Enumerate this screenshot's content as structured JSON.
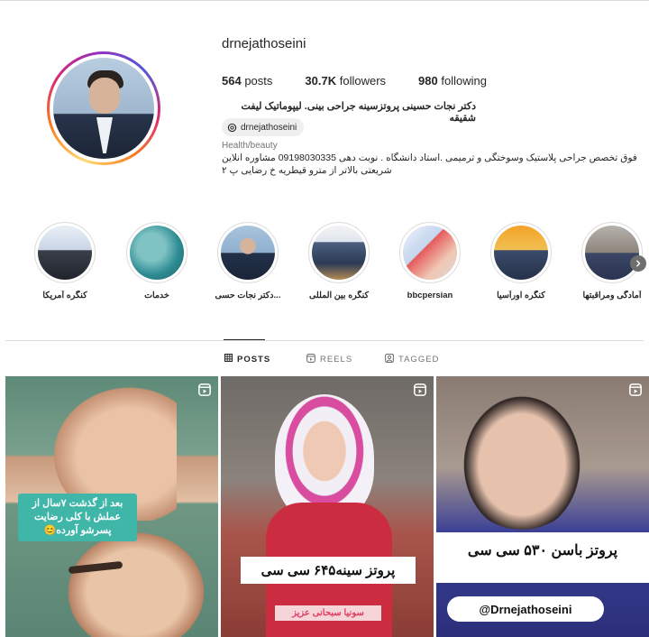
{
  "profile": {
    "username": "drnejathoseini",
    "stats": [
      {
        "value": "564",
        "label": "posts"
      },
      {
        "value": "30.7K",
        "label": "followers"
      },
      {
        "value": "980",
        "label": "following"
      }
    ],
    "bio_name": "دکتر نجات حسینی پروتزسینه جراحی بینی. لیپوماتیک لیفت شقیقه",
    "threads_handle": "drnejathoseini",
    "category": "Health/beauty",
    "bio_line1": "فوق تخصص جراحی پلاستیک وسوختگی و ترمیمی .استاد دانشگاه . نوبت دهی 09198030335 مشاوره انلاین",
    "bio_line2": "شریعتی بالاتر از مترو قیطریه خ رضایی پ ۲"
  },
  "highlights": [
    {
      "label": "کنگره آمریکا"
    },
    {
      "label": "خدمات"
    },
    {
      "label": "دکتر نجات حسی..."
    },
    {
      "label": "کنگره بین المللی"
    },
    {
      "label": "bbcpersian"
    },
    {
      "label": "کنگره اورآسیا"
    },
    {
      "label": "آمادگی ومراقبتها"
    }
  ],
  "tabs": [
    {
      "label": "POSTS"
    },
    {
      "label": "REELS"
    },
    {
      "label": "TAGGED"
    }
  ],
  "posts": [
    {
      "caption": "بعد از گذشت ۷سال از عملش با کلی رضایت پسرشو آورده😊"
    },
    {
      "caption": "پروتز سینه۶۴۵ سی سی",
      "subcaption": "سونیا سبحانی عزیز"
    },
    {
      "caption": "پروتز باسن ۵۳۰ سی سی",
      "handle": "@Drnejathoseini"
    }
  ]
}
